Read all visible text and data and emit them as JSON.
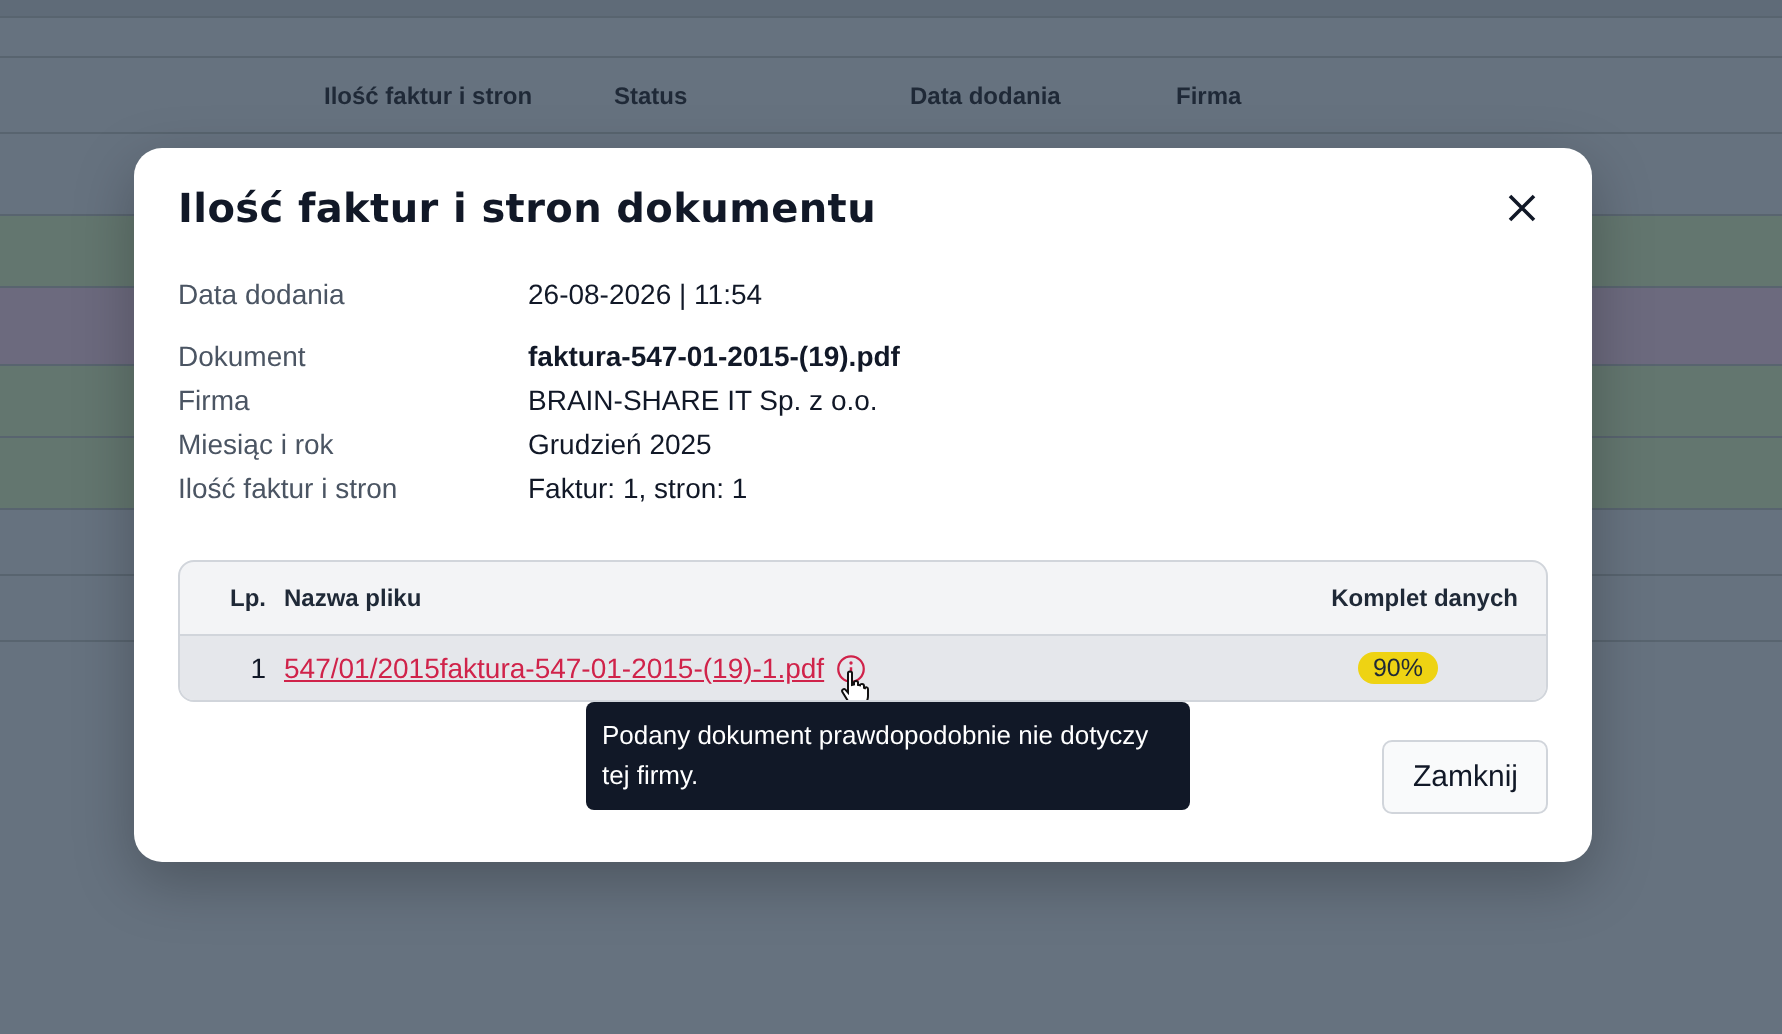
{
  "background_table": {
    "columns": [
      "Ilość faktur i stron",
      "Status",
      "Data dodania",
      "Firma"
    ]
  },
  "dialog": {
    "title": "Ilość faktur i stron dokumentu",
    "details": [
      {
        "label": "Data dodania",
        "value": "26-08-2026 | 11:54",
        "bold": false
      },
      {
        "label": "Dokument",
        "value": "faktura-547-01-2015-(19).pdf",
        "bold": true
      },
      {
        "label": "Firma",
        "value": "BRAIN-SHARE IT Sp. z o.o.",
        "bold": false
      },
      {
        "label": "Miesiąc i rok",
        "value": "Grudzień 2025",
        "bold": false
      },
      {
        "label": "Ilość faktur i stron",
        "value": "Faktur: 1, stron: 1",
        "bold": false
      }
    ],
    "files_table": {
      "columns": [
        "Lp.",
        "Nazwa pliku",
        "Komplet danych"
      ],
      "rows": [
        {
          "lp": "1",
          "file_name": "547/01/2015faktura-547-01-2015-(19)-1.pdf",
          "completeness": "90%"
        }
      ]
    },
    "tooltip": "Podany dokument prawdopodobnie nie dotyczy tej firmy.",
    "buttons": [
      "Zamknij"
    ]
  }
}
